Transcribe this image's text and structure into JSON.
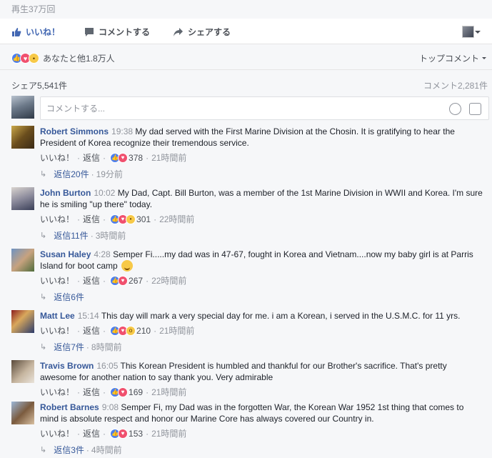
{
  "header": {
    "views": "再生37万回"
  },
  "actions": {
    "like": "いいね！",
    "comment": "コメントする",
    "share": "シェアする"
  },
  "reactions": {
    "summary": "あなたと他1.8万人",
    "sort": "トップコメント"
  },
  "stats": {
    "shares": "シェア5,541件",
    "comments": "コメント2,281件"
  },
  "composer": {
    "placeholder": "コメントする..."
  },
  "comment_meta": {
    "like": "いいね！",
    "reply": "返信"
  },
  "comments": [
    {
      "name": "Robert Simmons",
      "time": "19:38",
      "text": "My dad served with the First Marine Division at the Chosin. It is gratifying to hear the President of Korea recognize their tremendous service.",
      "reactions": "378",
      "ago": "21時間前",
      "replies": "返信20件",
      "replies_ago": "19分前"
    },
    {
      "name": "John Burton",
      "time": "10:02",
      "text": "My Dad, Capt. Bill Burton, was a member of the 1st Marine Division in WWII and Korea. I'm sure he is smiling \"up there\" today.",
      "reactions": "301",
      "ago": "22時間前",
      "replies": "返信11件",
      "replies_ago": "3時間前"
    },
    {
      "name": "Susan Haley",
      "time": "4:28",
      "text": "Semper Fi.....my dad was in 47-67, fought in Korea and Vietnam....now my baby girl is at Parris Island for boot camp",
      "reactions": "267",
      "ago": "22時間前",
      "replies": "返信6件",
      "replies_ago": ""
    },
    {
      "name": "Matt Lee",
      "time": "15:14",
      "text": "This day will mark a very special day for me. i am a Korean, i served in the U.S.M.C. for 11 yrs.",
      "reactions": "210",
      "ago": "21時間前",
      "replies": "返信7件",
      "replies_ago": "8時間前"
    },
    {
      "name": "Travis Brown",
      "time": "16:05",
      "text": "This Korean President is humbled and thankful for our Brother's sacrifice. That's pretty awesome for another nation to say thank you. Very admirable",
      "reactions": "169",
      "ago": "21時間前",
      "replies": "",
      "replies_ago": ""
    },
    {
      "name": "Robert Barnes",
      "time": "9:08",
      "text": "Semper Fi, my Dad was in the forgotten War, the Korean War 1952 1st thing that comes to mind is absolute respect and honor our Marine Core has always covered our Country in.",
      "reactions": "153",
      "ago": "21時間前",
      "replies": "返信3件",
      "replies_ago": "4時間前"
    }
  ],
  "colors": {
    "link": "#365899",
    "like_blue": "#4267b2",
    "muted": "#90949c"
  }
}
